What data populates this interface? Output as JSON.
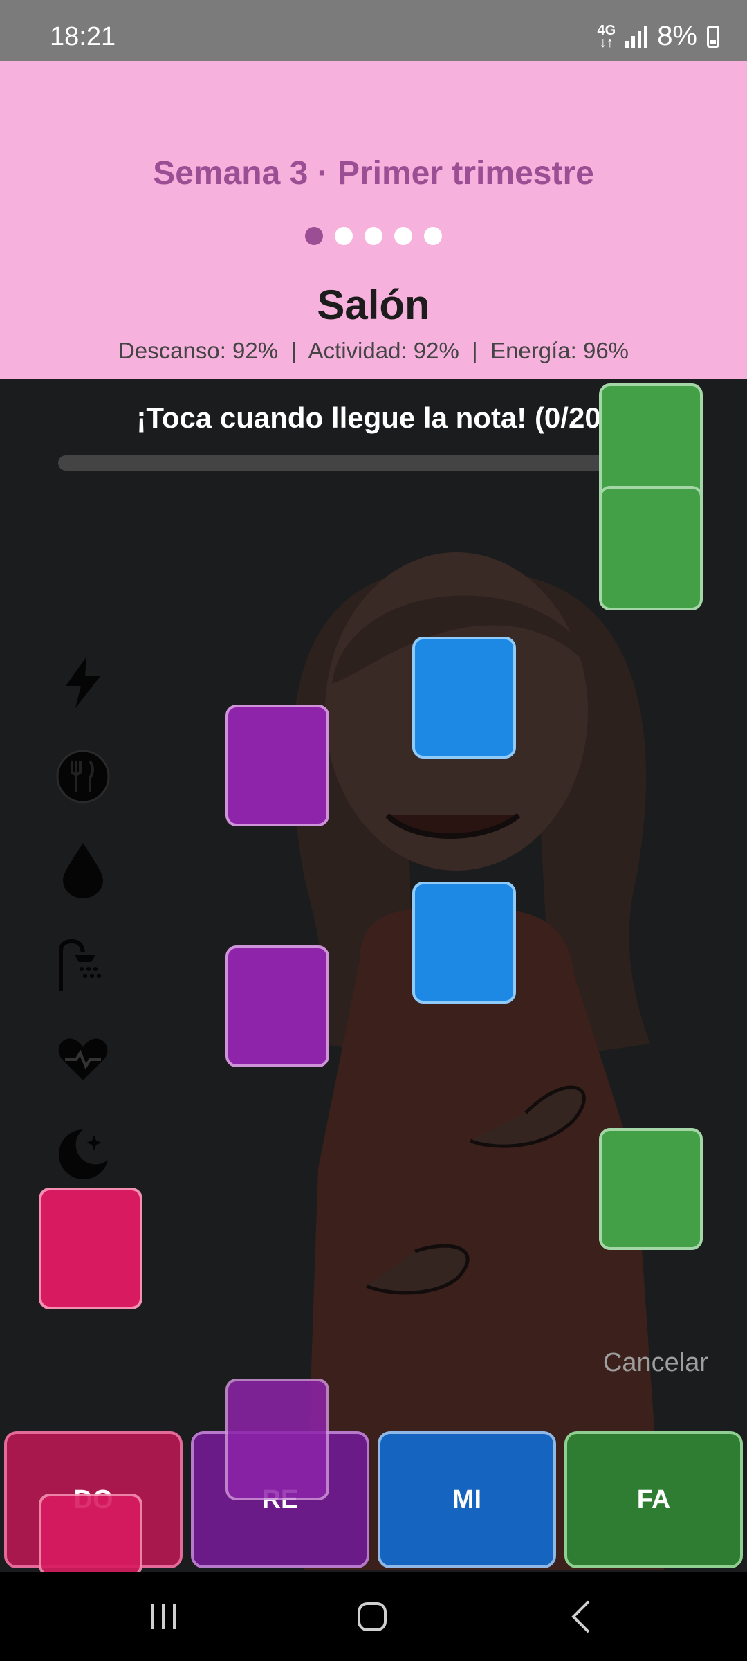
{
  "status_bar": {
    "time": "18:21",
    "network": "4G",
    "battery": "8%"
  },
  "header": {
    "week_label": "Semana 3 · Primer trimestre",
    "page_dots": {
      "count": 5,
      "active_index": 0
    },
    "room": "Salón",
    "stats": "Descanso: 92%  |  Actividad: 92%  |  Energía: 96%"
  },
  "game": {
    "prompt": "¡Toca cuando llegue la nota! (0/20)",
    "progress": 0,
    "side_icons": [
      "lightning-icon",
      "fork-knife-icon",
      "water-drop-icon",
      "shower-icon",
      "heart-pulse-icon",
      "moon-stars-icon"
    ],
    "cancel_label": "Cancelar",
    "lanes": [
      {
        "label": "DO",
        "color": "#d81b60"
      },
      {
        "label": "RE",
        "color": "#8e24aa"
      },
      {
        "label": "MI",
        "color": "#1e88e5"
      },
      {
        "label": "FA",
        "color": "#43a047"
      }
    ]
  },
  "nav_bar": {
    "items": [
      "recents-icon",
      "home-icon",
      "back-icon"
    ]
  }
}
